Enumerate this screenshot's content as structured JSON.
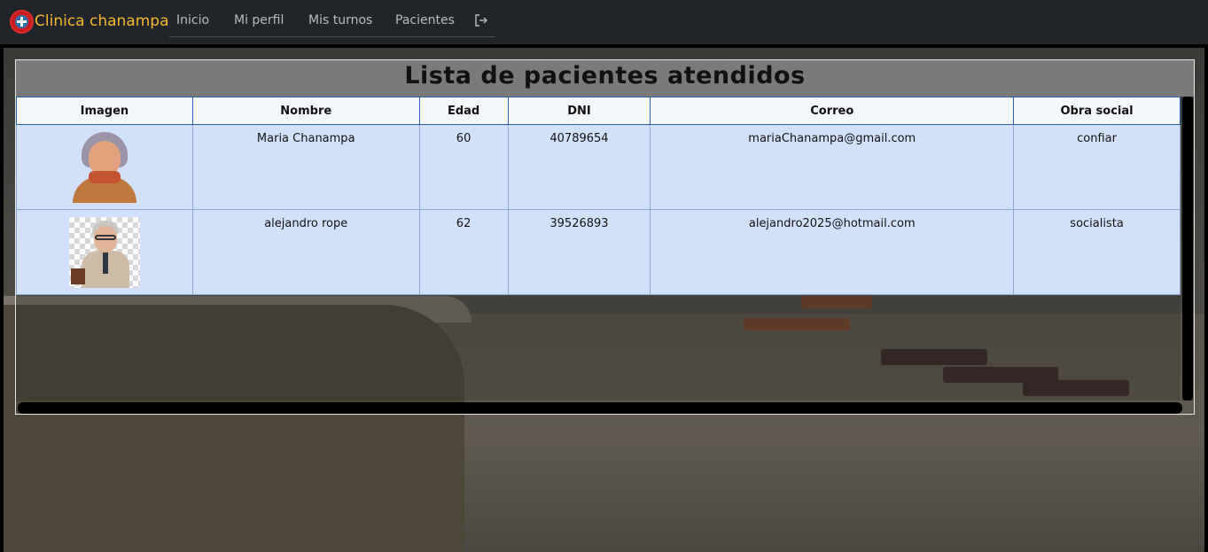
{
  "navbar": {
    "brand": "Clinica chanampa",
    "links": [
      "Inicio",
      "Mi perfil",
      "Mis turnos",
      "Pacientes"
    ],
    "logout_icon": "logout-icon"
  },
  "page": {
    "title": "Lista de pacientes atendidos"
  },
  "table": {
    "headers": [
      "Imagen",
      "Nombre",
      "Edad",
      "DNI",
      "Correo",
      "Obra social"
    ],
    "rows": [
      {
        "avatar": "elderly-woman-avatar",
        "nombre": "Maria Chanampa",
        "edad": "60",
        "dni": "40789654",
        "correo": "mariaChanampa@gmail.com",
        "obra_social": "confiar"
      },
      {
        "avatar": "elderly-man-avatar",
        "nombre": "alejandro rope",
        "edad": "62",
        "dni": "39526893",
        "correo": "alejandro2025@hotmail.com",
        "obra_social": "socialista"
      }
    ]
  },
  "colors": {
    "navbar_bg": "#212529",
    "brand": "#f6b72a",
    "header_bg": "#f4f7fb",
    "row_bg": "#d2e1fb"
  }
}
